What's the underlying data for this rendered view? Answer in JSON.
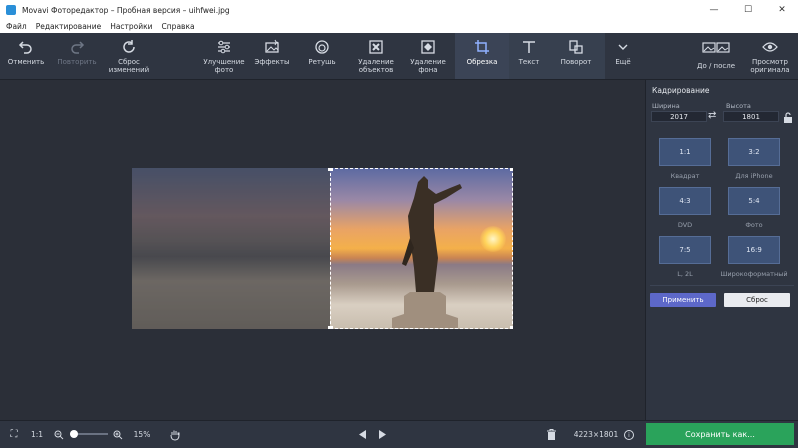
{
  "window": {
    "title": "Movavi Фоторедактор – Пробная версия – uihfwei.jpg",
    "controls": [
      "—",
      "☐",
      "✕"
    ]
  },
  "menu": [
    "Файл",
    "Редактирование",
    "Настройки",
    "Справка"
  ],
  "toolbar": {
    "undo": "Отменить",
    "redo": "Повторить",
    "reset": "Сброс\nизменений",
    "enhance": "Улучшение\nфото",
    "effects": "Эффекты",
    "retouch": "Ретушь",
    "remove_objects": "Удаление\nобъектов",
    "remove_bg": "Удаление\nфона",
    "crop": "Обрезка",
    "text": "Текст",
    "rotate": "Поворот",
    "more": "Ещё",
    "before_after": "До / после",
    "view_original": "Просмотр\nоригинала"
  },
  "icons": {
    "undo": "undo-icon",
    "redo": "redo-icon",
    "reset": "reset-icon",
    "enhance": "sliders-icon",
    "effects": "effects-icon",
    "retouch": "retouch-icon",
    "remove_objects": "remove-objects-icon",
    "remove_bg": "remove-bg-icon",
    "crop": "crop-icon",
    "text": "text-icon",
    "rotate": "rotate-icon",
    "more": "chevron-down-icon",
    "before_after": "before-after-icon",
    "view_original": "eye-icon"
  },
  "crop_panel": {
    "title": "Кадрирование",
    "width_label": "Ширина",
    "height_label": "Высота",
    "width_value": "2017",
    "height_value": "1801",
    "ratios": [
      {
        "ratio": "1:1",
        "label": "Квадрат"
      },
      {
        "ratio": "3:2",
        "label": "Для iPhone"
      },
      {
        "ratio": "4:3",
        "label": "DVD"
      },
      {
        "ratio": "5:4",
        "label": "Фото"
      },
      {
        "ratio": "7:5",
        "label": "L, 2L"
      },
      {
        "ratio": "16:9",
        "label": "Широкоформатный"
      }
    ],
    "apply": "Применить",
    "reset": "Сброс"
  },
  "bottom": {
    "fit": "⛶",
    "actual": "1:1",
    "zoom": "15%",
    "zoom_level": 0.15,
    "dimensions": "4223×1801",
    "info": "i",
    "save": "Сохранить как..."
  },
  "colors": {
    "accent": "#5d68c9",
    "save": "#2aa35b",
    "active_tool": "#3b4456"
  }
}
